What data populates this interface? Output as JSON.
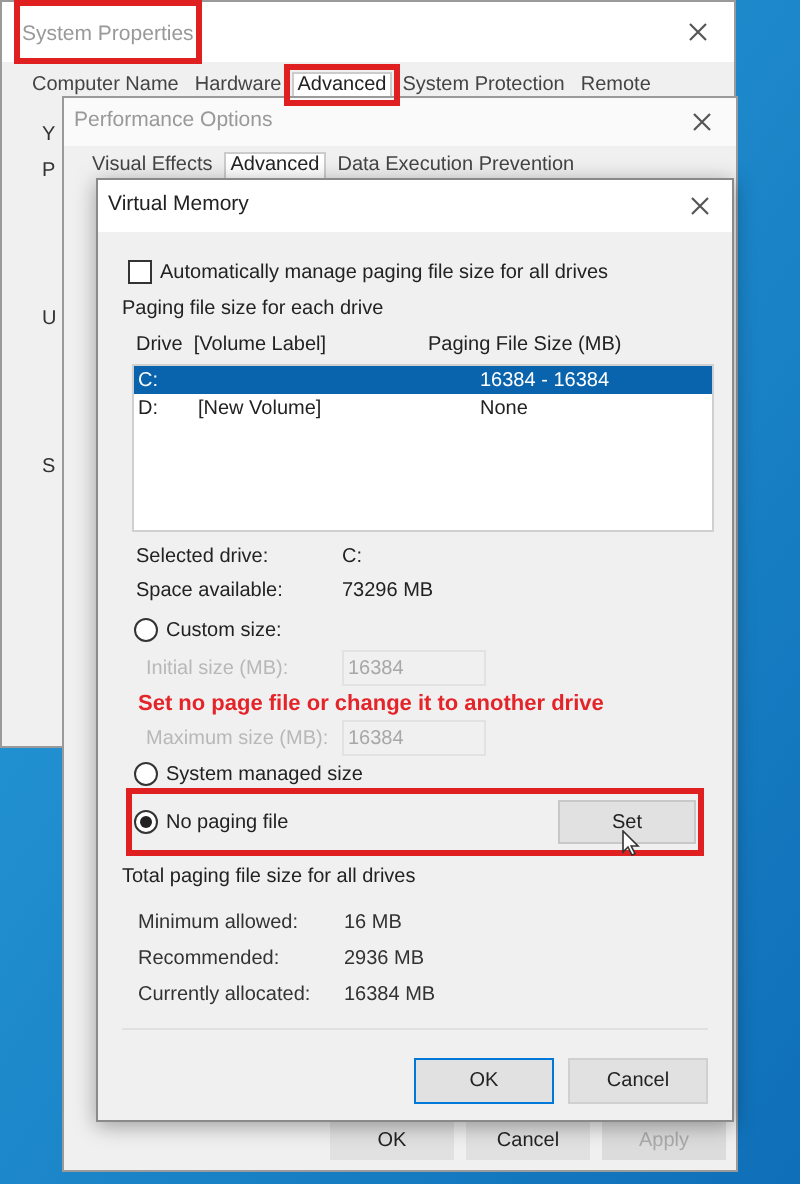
{
  "system_properties": {
    "title": "System Properties",
    "tabs": [
      {
        "label": "Computer Name",
        "selected": false
      },
      {
        "label": "Hardware",
        "selected": false
      },
      {
        "label": "Advanced",
        "selected": true
      },
      {
        "label": "System Protection",
        "selected": false
      },
      {
        "label": "Remote",
        "selected": false
      }
    ],
    "clipped_labels": [
      "Y",
      "P",
      "U",
      "S"
    ]
  },
  "performance_options": {
    "title": "Performance Options",
    "tabs": [
      {
        "label": "Visual Effects",
        "selected": false
      },
      {
        "label": "Advanced",
        "selected": true
      },
      {
        "label": "Data Execution Prevention",
        "selected": false
      }
    ],
    "buttons": [
      {
        "label": "OK",
        "disabled": false
      },
      {
        "label": "Cancel",
        "disabled": false
      },
      {
        "label": "Apply",
        "disabled": true
      }
    ]
  },
  "virtual_memory": {
    "title": "Virtual Memory",
    "auto_manage": {
      "label": "Automatically manage paging file size for all drives",
      "checked": false
    },
    "drives_heading": "Paging file size for each drive",
    "columns": [
      "Drive  [Volume Label]",
      "Paging File Size (MB)"
    ],
    "drives": [
      {
        "drive": "C:",
        "size": "16384 - 16384",
        "selected": true
      },
      {
        "drive": "D:",
        "label": "[New Volume]",
        "size": "None",
        "selected": false
      }
    ],
    "selected_drive": {
      "label": "Selected drive:",
      "value": "C:"
    },
    "space_available": {
      "label": "Space available:",
      "value": "73296 MB"
    },
    "options": [
      {
        "kind": "radio",
        "label": "Custom size:",
        "selected": false
      },
      {
        "kind": "field",
        "label": "Initial size (MB):",
        "value": "16384",
        "disabled": true
      },
      {
        "kind": "note"
      },
      {
        "kind": "field",
        "label": "Maximum size (MB):",
        "value": "16384",
        "disabled": true
      },
      {
        "kind": "radio",
        "label": "System managed size",
        "selected": false
      },
      {
        "kind": "radio",
        "label": "No paging file",
        "selected": true,
        "highlighted": true
      }
    ],
    "set_button": "Set",
    "totals_heading": "Total paging file size for all drives",
    "totals": [
      {
        "label": "Minimum allowed:",
        "value": "16 MB"
      },
      {
        "label": "Recommended:",
        "value": "2936 MB"
      },
      {
        "label": "Currently allocated:",
        "value": "16384 MB"
      }
    ],
    "buttons": [
      {
        "label": "OK",
        "default": true
      },
      {
        "label": "Cancel",
        "default": false
      }
    ]
  },
  "annotation": {
    "text": "Set no page file or change it to another drive"
  }
}
